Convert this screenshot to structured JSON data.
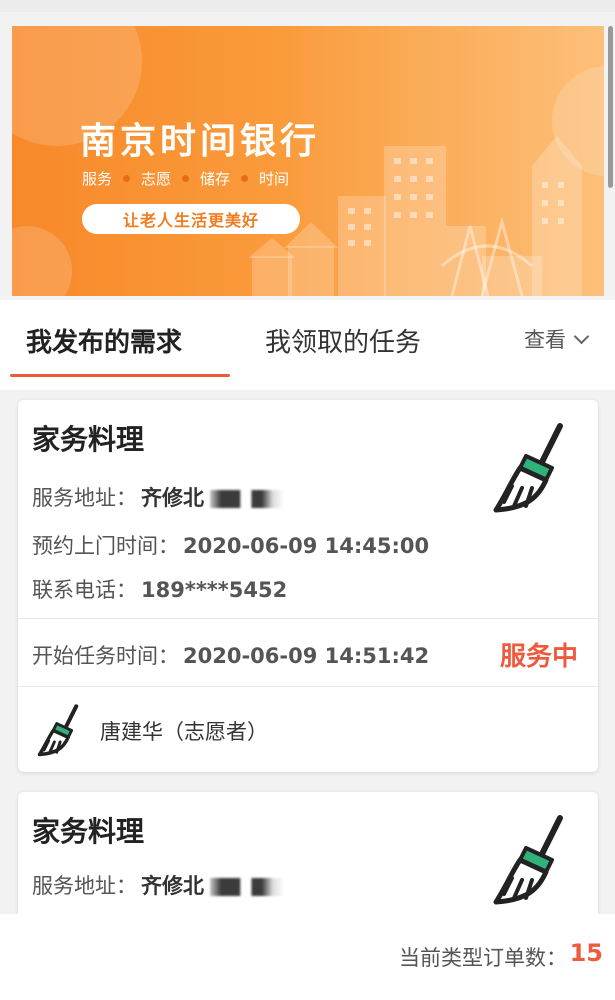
{
  "banner": {
    "title": "南京时间银行",
    "tags": [
      "服务",
      "志愿",
      "储存",
      "时间"
    ],
    "slogan": "让老人生活更美好"
  },
  "tabs": {
    "published": "我发布的需求",
    "claimed": "我领取的任务",
    "view": "查看"
  },
  "cards": [
    {
      "title": "家务料理",
      "address_label": "服务地址：",
      "address_value": "齐修北",
      "time_label": "预约上门时间：",
      "time_value": "2020-06-09 14:45:00",
      "phone_label": "联系电话：",
      "phone_value": "189****5452",
      "start_label": "开始任务时间：",
      "start_value": "2020-06-09 14:51:42",
      "status": "服务中",
      "volunteer": "唐建华（志愿者）",
      "icon": "broom-icon"
    },
    {
      "title": "家务料理",
      "address_label": "服务地址：",
      "address_value": "齐修北",
      "icon": "broom-icon"
    }
  ],
  "footer": {
    "label": "当前类型订单数：",
    "count": "15"
  },
  "colors": {
    "accent": "#ef5a3c",
    "banner": "#f7892a",
    "broom_green": "#2fb37a"
  }
}
